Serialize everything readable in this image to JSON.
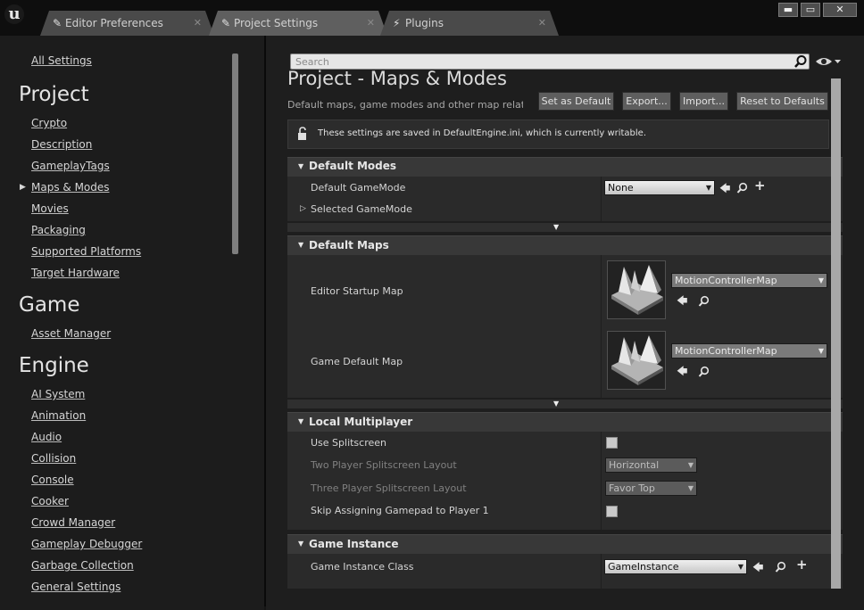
{
  "tabs": [
    {
      "label": "Editor Preferences",
      "icon": "editor-preferences-icon"
    },
    {
      "label": "Project Settings",
      "icon": "project-settings-icon"
    },
    {
      "label": "Plugins",
      "icon": "plugins-icon"
    }
  ],
  "window_controls": {
    "minimize": "▬",
    "maximize": "▭",
    "close": "✕"
  },
  "sidebar": {
    "all_settings": "All Settings",
    "sections": [
      {
        "heading": "Project",
        "items": [
          "Crypto",
          "Description",
          "GameplayTags",
          "Maps & Modes",
          "Movies",
          "Packaging",
          "Supported Platforms",
          "Target Hardware"
        ]
      },
      {
        "heading": "Game",
        "items": [
          "Asset Manager"
        ]
      },
      {
        "heading": "Engine",
        "items": [
          "AI System",
          "Animation",
          "Audio",
          "Collision",
          "Console",
          "Cooker",
          "Crowd Manager",
          "Gameplay Debugger",
          "Garbage Collection",
          "General Settings"
        ]
      }
    ],
    "selected": "Maps & Modes"
  },
  "search": {
    "placeholder": "Search"
  },
  "page": {
    "title": "Project - Maps & Modes",
    "subtitle": "Default maps, game modes and other map related"
  },
  "buttons": {
    "set_default": "Set as Default",
    "export": "Export...",
    "import": "Import...",
    "reset": "Reset to Defaults"
  },
  "notice": "These settings are saved in DefaultEngine.ini, which is currently writable.",
  "sections": {
    "default_modes": {
      "title": "Default Modes",
      "default_gamemode_label": "Default GameMode",
      "default_gamemode_value": "None",
      "selected_gamemode_label": "Selected GameMode"
    },
    "default_maps": {
      "title": "Default Maps",
      "editor_startup_label": "Editor Startup Map",
      "editor_startup_value": "MotionControllerMap",
      "game_default_label": "Game Default Map",
      "game_default_value": "MotionControllerMap"
    },
    "local_multiplayer": {
      "title": "Local Multiplayer",
      "use_splitscreen_label": "Use Splitscreen",
      "use_splitscreen_checked": false,
      "two_player_label": "Two Player Splitscreen Layout",
      "two_player_value": "Horizontal",
      "three_player_label": "Three Player Splitscreen Layout",
      "three_player_value": "Favor Top",
      "skip_gamepad_label": "Skip Assigning Gamepad to Player 1",
      "skip_gamepad_checked": false
    },
    "game_instance": {
      "title": "Game Instance",
      "class_label": "Game Instance Class",
      "class_value": "GameInstance"
    }
  },
  "colors": {
    "background": "#151515",
    "section_header": "#383838",
    "section_body": "#2a2a2a",
    "scrollbar": "#a8a8a8"
  }
}
